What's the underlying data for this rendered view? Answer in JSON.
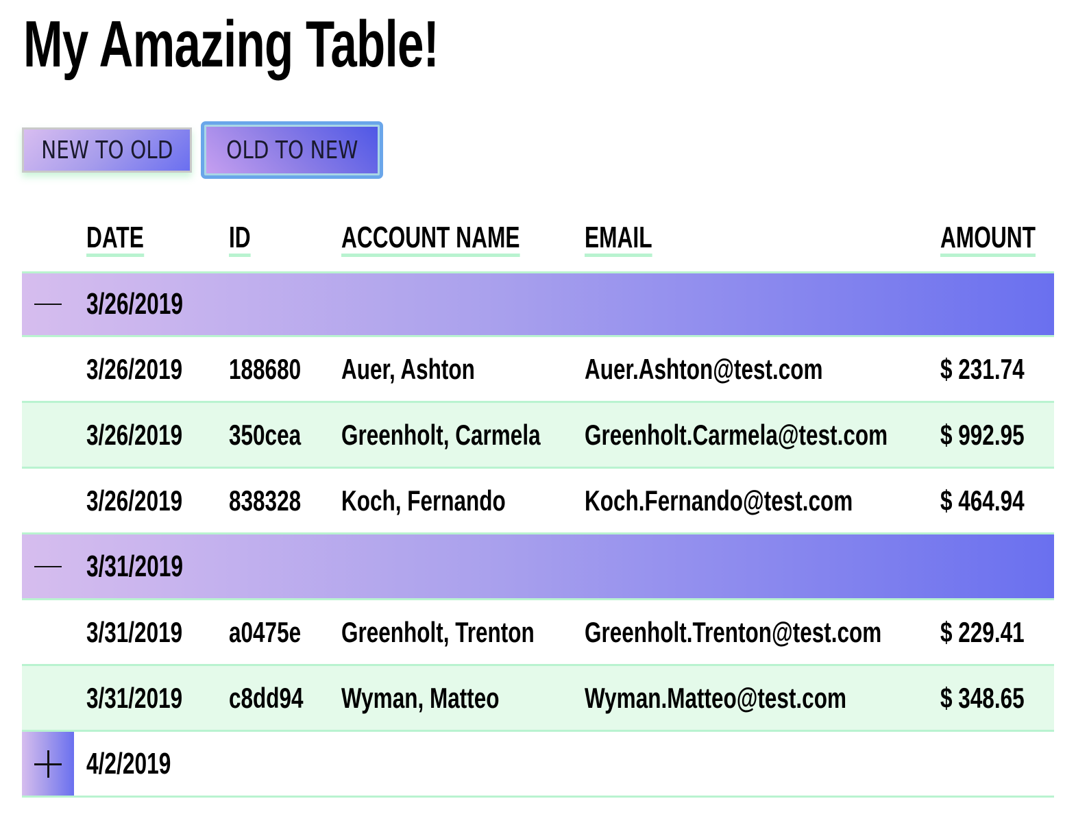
{
  "title": "My Amazing Table!",
  "sort_buttons": {
    "new_to_old": "NEW TO OLD",
    "old_to_new": "OLD TO NEW",
    "active": "old_to_new"
  },
  "columns": [
    "DATE",
    "ID",
    "ACCOUNT NAME",
    "EMAIL",
    "AMOUNT"
  ],
  "colors": {
    "accent_green": "#b9f3d0",
    "alt_row": "#e4faea",
    "gradient_start": "#d6bdee",
    "gradient_end": "#6a70ef"
  },
  "groups": [
    {
      "date": "3/26/2019",
      "expanded": true,
      "toggle_icon": "minus-icon",
      "rows": [
        {
          "date": "3/26/2019",
          "id": "188680",
          "name": "Auer, Ashton",
          "email": "Auer.Ashton@test.com",
          "amount": "$ 231.74"
        },
        {
          "date": "3/26/2019",
          "id": "350cea",
          "name": "Greenholt, Carmela",
          "email": "Greenholt.Carmela@test.com",
          "amount": "$ 992.95"
        },
        {
          "date": "3/26/2019",
          "id": "838328",
          "name": "Koch, Fernando",
          "email": "Koch.Fernando@test.com",
          "amount": "$ 464.94"
        }
      ]
    },
    {
      "date": "3/31/2019",
      "expanded": true,
      "toggle_icon": "minus-icon",
      "rows": [
        {
          "date": "3/31/2019",
          "id": "a0475e",
          "name": "Greenholt, Trenton",
          "email": "Greenholt.Trenton@test.com",
          "amount": "$ 229.41"
        },
        {
          "date": "3/31/2019",
          "id": "c8dd94",
          "name": "Wyman, Matteo",
          "email": "Wyman.Matteo@test.com",
          "amount": "$ 348.65"
        }
      ]
    },
    {
      "date": "4/2/2019",
      "expanded": false,
      "toggle_icon": "plus-icon",
      "rows": []
    }
  ]
}
